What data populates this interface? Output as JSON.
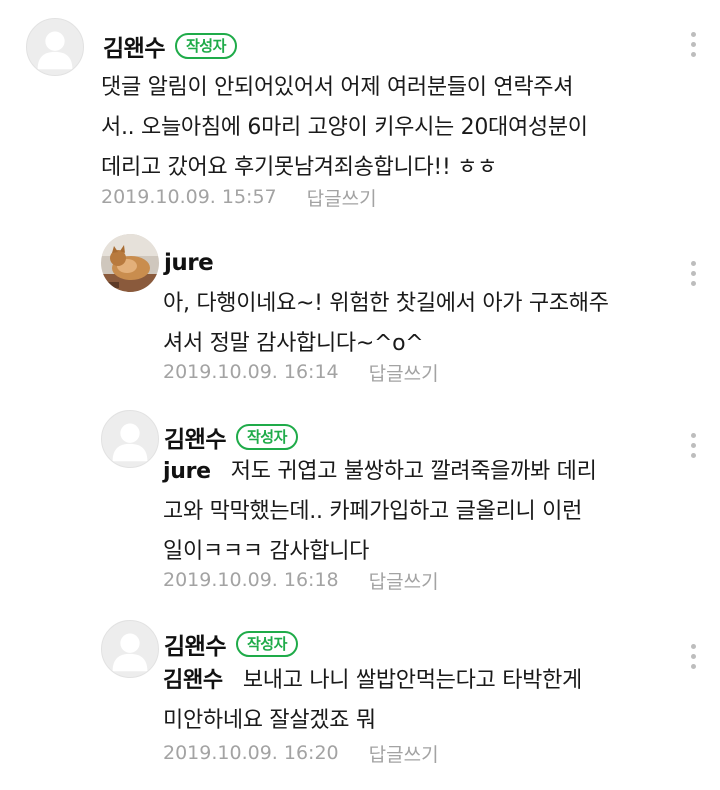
{
  "reply_label": "답글쓰기",
  "comments": [
    {
      "author": "김왠수",
      "badge": "작성자",
      "lines": [
        "댓글 알림이 안되어있어서 어제 여러분들이 연락주셔",
        "서.. 오늘아침에 6마리 고양이 키우시는 20대여성분이",
        "데리고 갔어요 후기못남겨죄송합니다!! ㅎㅎ"
      ],
      "timestamp": "2019.10.09. 15:57"
    },
    {
      "author": "jure",
      "lines": [
        "아, 다행이네요~! 위험한 찻길에서 아가 구조해주",
        "셔서 정말 감사합니다~^o^"
      ],
      "timestamp": "2019.10.09. 16:14"
    },
    {
      "author": "김왠수",
      "badge": "작성자",
      "mention": "jure",
      "lines": [
        "저도 귀엽고 불쌍하고 깔려죽을까봐 데리",
        "고와 막막했는데.. 카페가입하고 글올리니 이런",
        "일이ㅋㅋㅋ 감사합니다"
      ],
      "timestamp": "2019.10.09. 16:18"
    },
    {
      "author": "김왠수",
      "badge": "작성자",
      "mention": "김왠수",
      "lines": [
        "보내고 나니 쌀밥안먹는다고 타박한게",
        "미안하네요 잘살겠죠 뭐"
      ],
      "timestamp": "2019.10.09. 16:20"
    }
  ],
  "icons": {
    "default_avatar": "person-silhouette-icon",
    "cat_avatar": "cat-photo-avatar",
    "more": "vertical-ellipsis-icon"
  },
  "colors": {
    "badge_green": "#1fab49",
    "meta_gray": "#a3a3a3",
    "text": "#1a1a1a"
  }
}
